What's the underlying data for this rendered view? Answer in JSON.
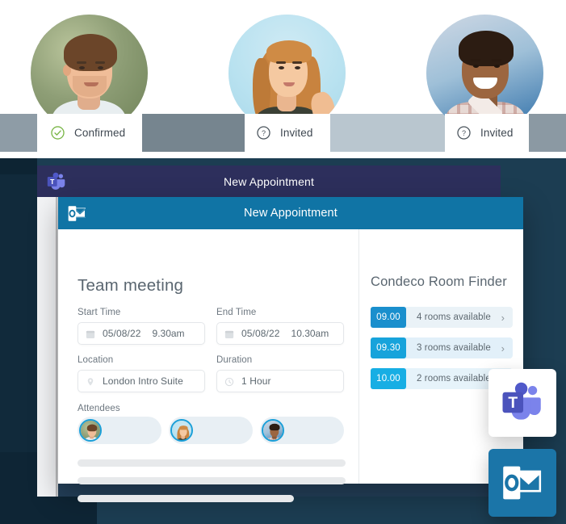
{
  "attendee_status": {
    "items": [
      {
        "icon": "check-circle-icon",
        "label": "Confirmed",
        "color": "#7ab648"
      },
      {
        "icon": "question-circle-icon",
        "label": "Invited",
        "color": "#4a545c"
      },
      {
        "icon": "question-circle-icon",
        "label": "Invited",
        "color": "#4a545c"
      }
    ]
  },
  "teams_window": {
    "icon": "microsoft-teams-icon",
    "title": "New Appointment"
  },
  "outlook_window": {
    "icon": "microsoft-outlook-icon",
    "title": "New Appointment",
    "meeting_title": "Team meeting",
    "fields": {
      "start_time": {
        "label": "Start Time",
        "icon": "calendar-icon",
        "date": "05/08/22",
        "time": "9.30am"
      },
      "end_time": {
        "label": "End Time",
        "icon": "calendar-icon",
        "date": "05/08/22",
        "time": "10.30am"
      },
      "location": {
        "label": "Location",
        "icon": "location-pin-icon",
        "value": "London Intro Suite"
      },
      "duration": {
        "label": "Duration",
        "icon": "clock-icon",
        "value": "1 Hour"
      }
    },
    "attendees": {
      "label": "Attendees",
      "chips": [
        {
          "avatar": "avatar-attendee-1"
        },
        {
          "avatar": "avatar-attendee-2"
        },
        {
          "avatar": "avatar-attendee-3"
        }
      ]
    }
  },
  "room_finder": {
    "title": "Condeco Room Finder",
    "rows": [
      {
        "time": "09.00",
        "availability": "4 rooms available",
        "chevron": "›",
        "badge_color": "#1a8fcd"
      },
      {
        "time": "09.30",
        "availability": "3 rooms available",
        "chevron": "›",
        "badge_color": "#17a3db"
      },
      {
        "time": "10.00",
        "availability": "2 rooms available",
        "chevron": "›",
        "badge_color": "#17aee4"
      }
    ]
  },
  "app_tiles": [
    {
      "name": "microsoft-teams-tile",
      "icon": "microsoft-teams-icon",
      "background": "#ffffff"
    },
    {
      "name": "microsoft-outlook-tile",
      "icon": "microsoft-outlook-icon",
      "background": "#1b75a8"
    }
  ],
  "theme": {
    "outlook_header": "#1074a5",
    "teams_header": "#2d2f5c",
    "backdrop": "#1c3d52",
    "status_band": "#8c9aa4"
  }
}
